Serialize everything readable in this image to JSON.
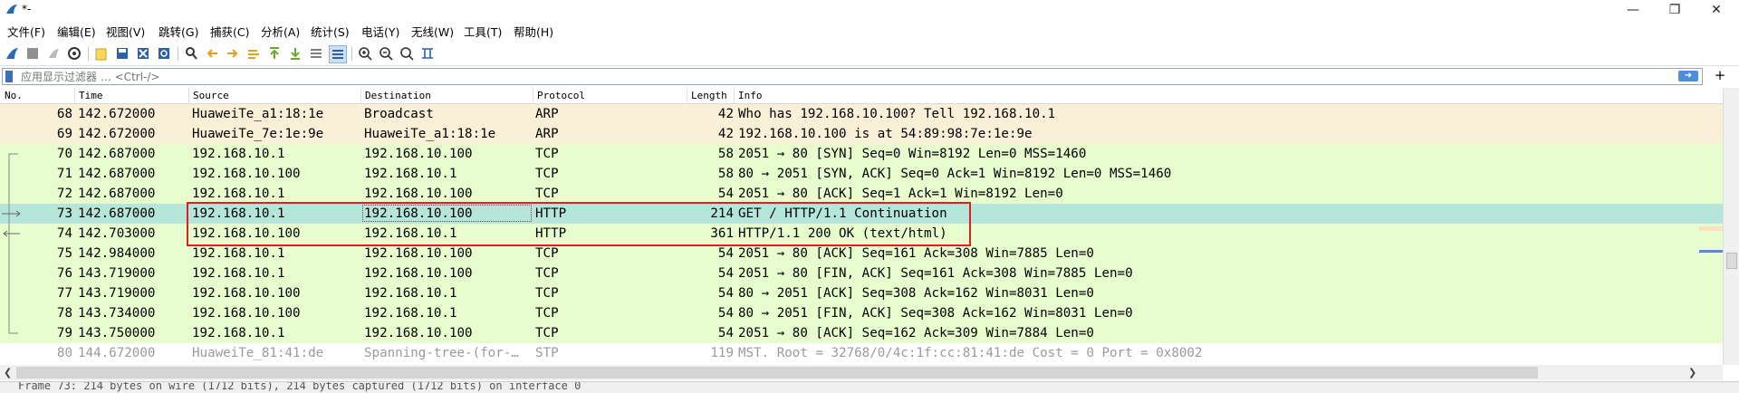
{
  "window": {
    "title": "*-"
  },
  "menu": [
    "文件(F)",
    "编辑(E)",
    "视图(V)",
    "跳转(G)",
    "捕获(C)",
    "分析(A)",
    "统计(S)",
    "电话(Y)",
    "无线(W)",
    "工具(T)",
    "帮助(H)"
  ],
  "filter": {
    "placeholder": "应用显示过滤器 … <Ctrl-/>",
    "value": ""
  },
  "columns": {
    "no": "No.",
    "time": "Time",
    "source": "Source",
    "destination": "Destination",
    "protocol": "Protocol",
    "length": "Length",
    "info": "Info"
  },
  "packets": [
    {
      "no": "68",
      "time": "142.672000",
      "source": "HuaweiTe_a1:18:1e",
      "destination": "Broadcast",
      "protocol": "ARP",
      "length": "42",
      "info": "Who has 192.168.10.100? Tell 192.168.10.1",
      "color": "#faf0d7",
      "fg": "#000000"
    },
    {
      "no": "69",
      "time": "142.672000",
      "source": "HuaweiTe_7e:1e:9e",
      "destination": "HuaweiTe_a1:18:1e",
      "protocol": "ARP",
      "length": "42",
      "info": "192.168.10.100 is at 54:89:98:7e:1e:9e",
      "color": "#faf0d7",
      "fg": "#000000"
    },
    {
      "no": "70",
      "time": "142.687000",
      "source": "192.168.10.1",
      "destination": "192.168.10.100",
      "protocol": "TCP",
      "length": "58",
      "info": "2051 → 80 [SYN] Seq=0 Win=8192 Len=0 MSS=1460",
      "color": "#e7fdcd",
      "fg": "#000000"
    },
    {
      "no": "71",
      "time": "142.687000",
      "source": "192.168.10.100",
      "destination": "192.168.10.1",
      "protocol": "TCP",
      "length": "58",
      "info": "80 → 2051 [SYN, ACK] Seq=0 Ack=1 Win=8192 Len=0 MSS=1460",
      "color": "#e7fdcd",
      "fg": "#000000"
    },
    {
      "no": "72",
      "time": "142.687000",
      "source": "192.168.10.1",
      "destination": "192.168.10.100",
      "protocol": "TCP",
      "length": "54",
      "info": "2051 → 80 [ACK] Seq=1 Ack=1 Win=8192 Len=0",
      "color": "#e7fdcd",
      "fg": "#000000"
    },
    {
      "no": "73",
      "time": "142.687000",
      "source": "192.168.10.1",
      "destination": "192.168.10.100",
      "protocol": "HTTP",
      "length": "214",
      "info": "GET / HTTP/1.1 Continuation",
      "color": "#b5e6d9",
      "fg": "#000000"
    },
    {
      "no": "74",
      "time": "142.703000",
      "source": "192.168.10.100",
      "destination": "192.168.10.1",
      "protocol": "HTTP",
      "length": "361",
      "info": "HTTP/1.1 200 OK  (text/html)",
      "color": "#e7fdcd",
      "fg": "#000000"
    },
    {
      "no": "75",
      "time": "142.984000",
      "source": "192.168.10.1",
      "destination": "192.168.10.100",
      "protocol": "TCP",
      "length": "54",
      "info": "2051 → 80 [ACK] Seq=161 Ack=308 Win=7885 Len=0",
      "color": "#e7fdcd",
      "fg": "#000000"
    },
    {
      "no": "76",
      "time": "143.719000",
      "source": "192.168.10.1",
      "destination": "192.168.10.100",
      "protocol": "TCP",
      "length": "54",
      "info": "2051 → 80 [FIN, ACK] Seq=161 Ack=308 Win=7885 Len=0",
      "color": "#e7fdcd",
      "fg": "#000000"
    },
    {
      "no": "77",
      "time": "143.719000",
      "source": "192.168.10.100",
      "destination": "192.168.10.1",
      "protocol": "TCP",
      "length": "54",
      "info": "80 → 2051 [ACK] Seq=308 Ack=162 Win=8031 Len=0",
      "color": "#e7fdcd",
      "fg": "#000000"
    },
    {
      "no": "78",
      "time": "143.734000",
      "source": "192.168.10.100",
      "destination": "192.168.10.1",
      "protocol": "TCP",
      "length": "54",
      "info": "80 → 2051 [FIN, ACK] Seq=308 Ack=162 Win=8031 Len=0",
      "color": "#e7fdcd",
      "fg": "#000000"
    },
    {
      "no": "79",
      "time": "143.750000",
      "source": "192.168.10.1",
      "destination": "192.168.10.100",
      "protocol": "TCP",
      "length": "54",
      "info": "2051 → 80 [ACK] Seq=162 Ack=309 Win=7884 Len=0",
      "color": "#e7fdcd",
      "fg": "#000000"
    },
    {
      "no": "80",
      "time": "144.672000",
      "source": "HuaweiTe_81:41:de",
      "destination": "Spanning-tree-(for-…",
      "protocol": "STP",
      "length": "119",
      "info": "MST. Root = 32768/0/4c:1f:cc:81:41:de  Cost = 0  Port = 0x8002",
      "color": "#ffffff",
      "fg": "#9a9a9a"
    }
  ],
  "selected_packet": "73",
  "status": {
    "text": "Frame 73: 214 bytes on wire (1712 bits), 214 bytes captured (1712 bits) on interface 0"
  },
  "colors": {
    "accent": "#3c6fb8",
    "highlight_box": "#e02020"
  }
}
